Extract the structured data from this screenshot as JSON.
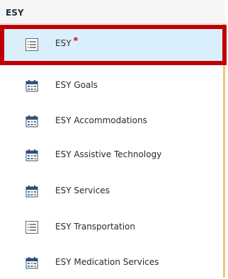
{
  "section": {
    "title": "ESY"
  },
  "items": [
    {
      "label": "ESY",
      "required_mark": "*",
      "icon": "list-icon",
      "selected": true
    },
    {
      "label": "ESY Goals",
      "icon": "calendar-icon"
    },
    {
      "label": "ESY Accommodations",
      "icon": "calendar-icon"
    },
    {
      "label": "ESY Assistive Technology",
      "icon": "calendar-icon"
    },
    {
      "label": "ESY Services",
      "icon": "calendar-icon"
    },
    {
      "label": "ESY Transportation",
      "icon": "list-icon"
    },
    {
      "label": "ESY Medication Services",
      "icon": "calendar-icon"
    }
  ],
  "colors": {
    "selected_background": "#d9effb",
    "selection_outline": "#c00000",
    "panel_border": "#f3c478",
    "required_mark": "#d00000"
  }
}
